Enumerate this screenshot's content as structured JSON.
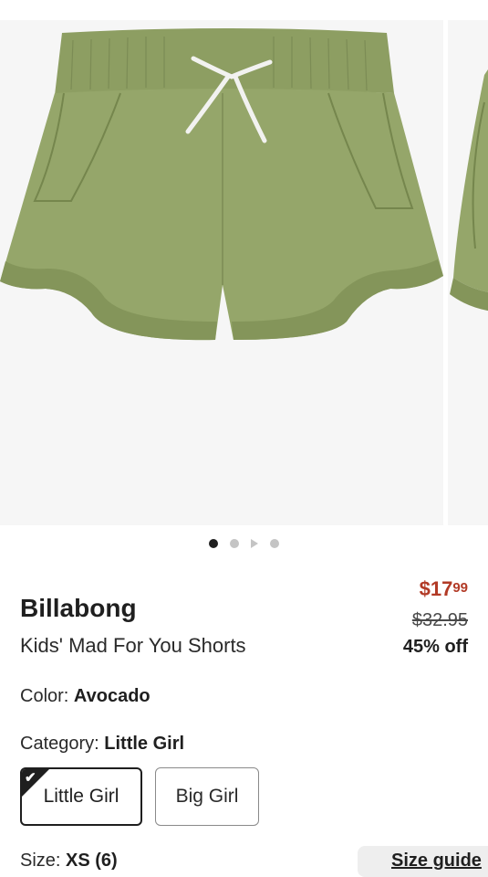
{
  "gallery": {
    "image_alt": "Green scalloped-hem pull-on shorts with white drawstring",
    "image_color": "#8fa064",
    "dots": [
      {
        "kind": "dot",
        "active": true
      },
      {
        "kind": "dot",
        "active": false
      },
      {
        "kind": "play",
        "active": false
      },
      {
        "kind": "dot",
        "active": false
      }
    ]
  },
  "product": {
    "brand": "Billabong",
    "name": "Kids' Mad For You Shorts"
  },
  "price": {
    "current_dollars": "$17",
    "current_cents": "99",
    "original": "$32.95",
    "discount": "45% off",
    "sale_color": "#b23a26"
  },
  "color": {
    "label": "Color: ",
    "value": "Avocado"
  },
  "category": {
    "label": "Category: ",
    "value": "Little Girl",
    "options": [
      {
        "label": "Little Girl",
        "selected": true
      },
      {
        "label": "Big Girl",
        "selected": false
      }
    ]
  },
  "size": {
    "label": "Size: ",
    "value": "XS (6)",
    "guide_label": "Size guide"
  },
  "icons": {
    "check": "checkmark-icon",
    "play": "play-icon"
  }
}
